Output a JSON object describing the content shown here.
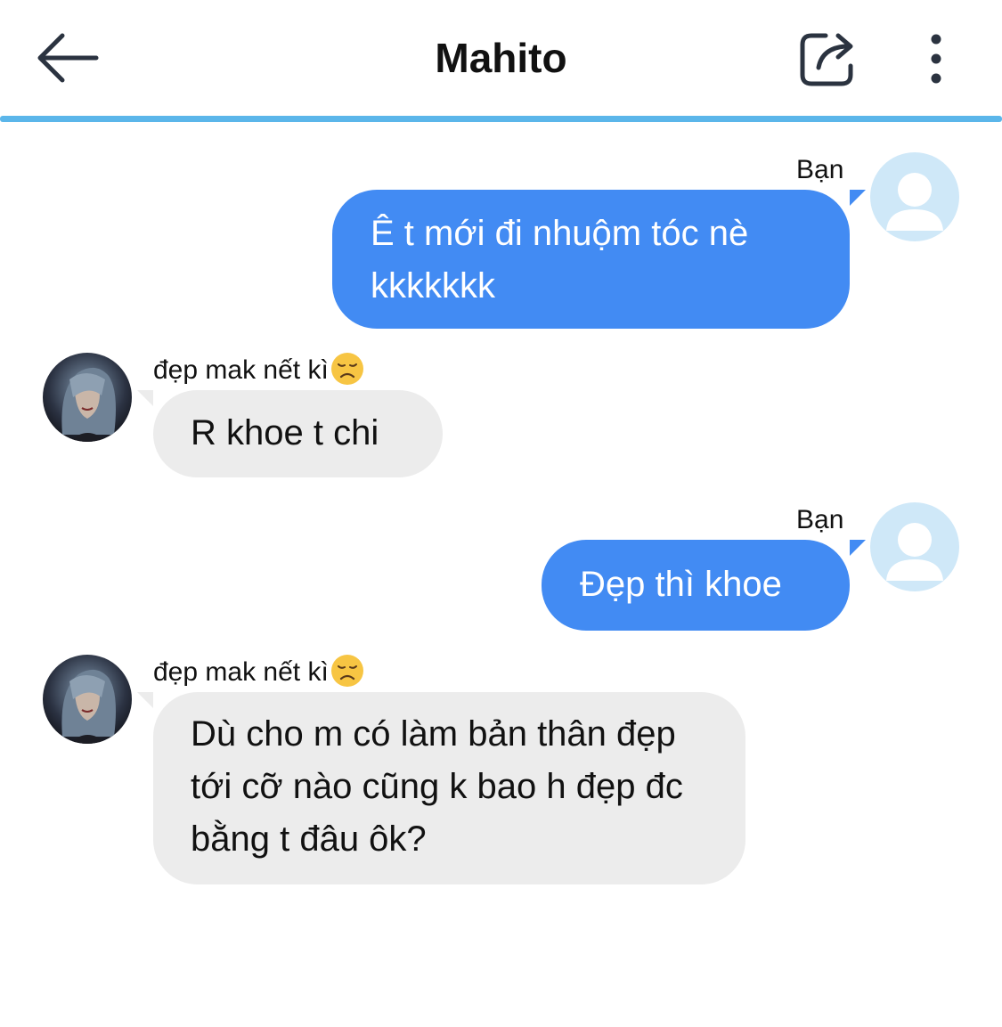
{
  "header": {
    "title": "Mahito",
    "back_icon": "arrow-left-icon",
    "share_icon": "share-icon",
    "more_icon": "more-vertical-icon",
    "accent_color": "#5bb6ea"
  },
  "messages": [
    {
      "direction": "outgoing",
      "sender": "Bạn",
      "text": "Ê t mới đi nhuộm tóc nè kkkkkkk"
    },
    {
      "direction": "incoming",
      "sender": "đẹp mak nết kì",
      "sender_emoji": "disappointed-face-emoji",
      "text": "R khoe t chi"
    },
    {
      "direction": "outgoing",
      "sender": "Bạn",
      "text": "Đẹp thì khoe"
    },
    {
      "direction": "incoming",
      "sender": "đẹp mak nết kì",
      "sender_emoji": "disappointed-face-emoji",
      "text": "Dù cho m có làm bản thân đẹp tới cỡ nào cũng k bao h đẹp đc bằng t đâu ôk?"
    }
  ],
  "colors": {
    "outgoing_bubble": "#428bf3",
    "incoming_bubble": "#ececec",
    "default_avatar": "#cfe8f8"
  }
}
